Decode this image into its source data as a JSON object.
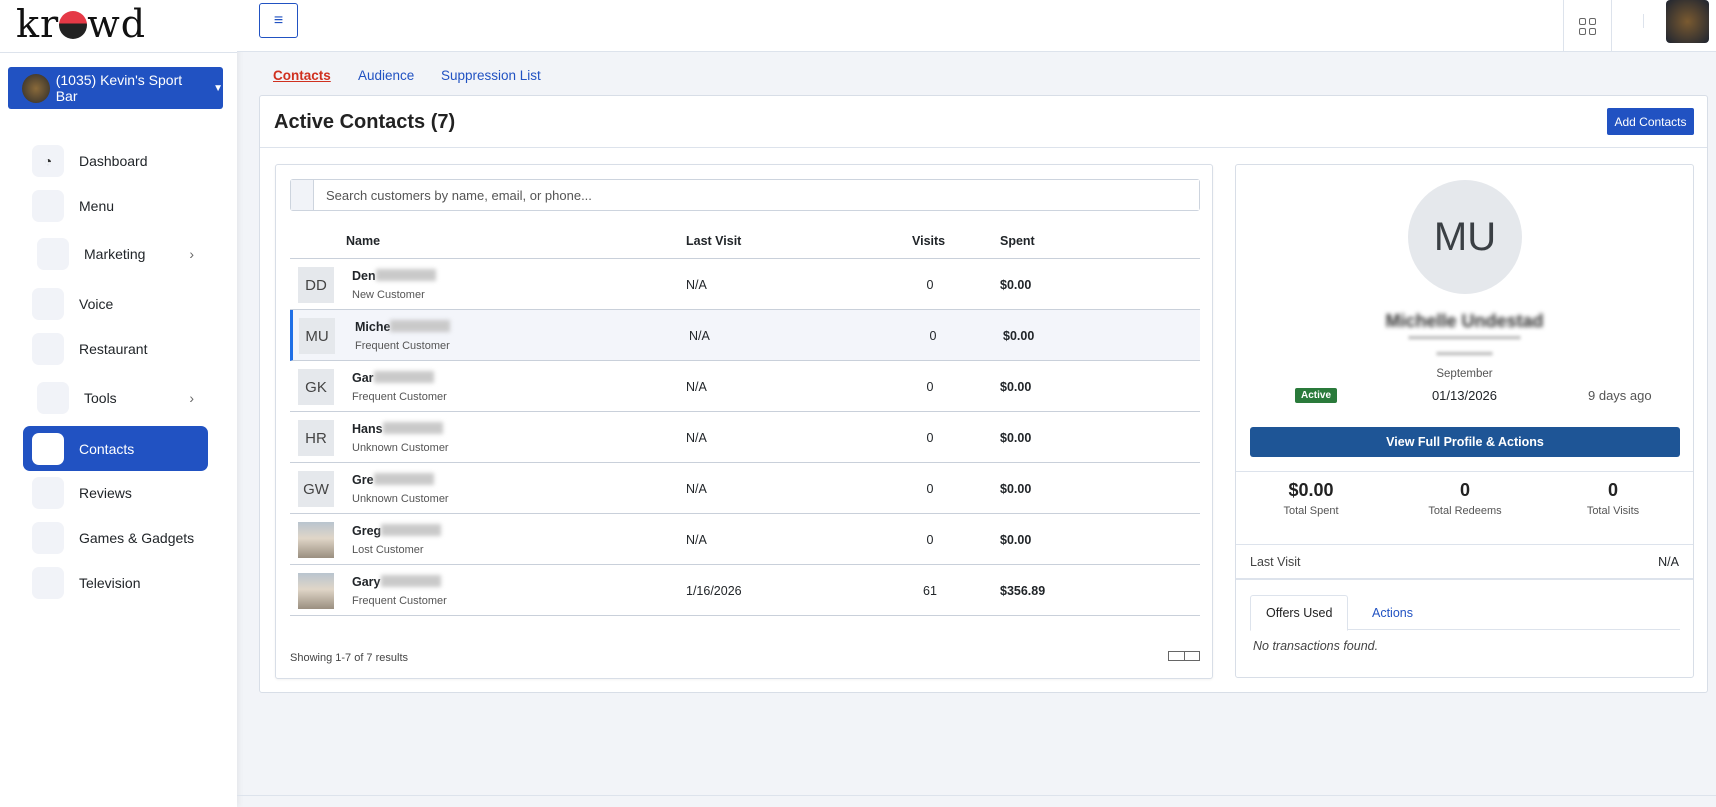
{
  "brand": {
    "logo": "krowd"
  },
  "venue": {
    "label": "(1035) Kevin's Sport Bar"
  },
  "sidebar": {
    "items": [
      {
        "label": "Dashboard",
        "icon": "gauge-icon"
      },
      {
        "label": "Menu"
      },
      {
        "label": "Marketing",
        "has_submenu": true
      },
      {
        "label": "Voice"
      },
      {
        "label": "Restaurant"
      },
      {
        "label": "Tools",
        "has_submenu": true
      },
      {
        "label": "Contacts",
        "active": true
      },
      {
        "label": "Reviews"
      },
      {
        "label": "Games & Gadgets"
      },
      {
        "label": "Television"
      }
    ]
  },
  "tabs": [
    {
      "label": "Contacts",
      "active": true
    },
    {
      "label": "Audience"
    },
    {
      "label": "Suppression List"
    }
  ],
  "main": {
    "title": "Active Contacts (7)",
    "add_label": "Add Contacts",
    "search_placeholder": "Search customers by name, email, or phone...",
    "columns": {
      "name": "Name",
      "last_visit": "Last Visit",
      "visits": "Visits",
      "spent": "Spent"
    },
    "rows": [
      {
        "initials": "DD",
        "name": "Den",
        "type": "New Customer",
        "last_visit": "N/A",
        "visits": "0",
        "spent": "$0.00"
      },
      {
        "initials": "MU",
        "name": "Miche",
        "type": "Frequent Customer",
        "last_visit": "N/A",
        "visits": "0",
        "spent": "$0.00",
        "selected": true
      },
      {
        "initials": "GK",
        "name": "Gar",
        "type": "Frequent Customer",
        "last_visit": "N/A",
        "visits": "0",
        "spent": "$0.00"
      },
      {
        "initials": "HR",
        "name": "Hans",
        "type": "Unknown Customer",
        "last_visit": "N/A",
        "visits": "0",
        "spent": "$0.00"
      },
      {
        "initials": "GW",
        "name": "Gre",
        "type": "Unknown Customer",
        "last_visit": "N/A",
        "visits": "0",
        "spent": "$0.00"
      },
      {
        "initials": "",
        "name": "Greg",
        "type": "Lost Customer",
        "last_visit": "N/A",
        "visits": "0",
        "spent": "$0.00",
        "photo": true
      },
      {
        "initials": "",
        "name": "Gary",
        "type": "Frequent Customer",
        "last_visit": "1/16/2026",
        "visits": "61",
        "spent": "$356.89",
        "photo": true
      }
    ],
    "showing": "Showing 1-7 of 7 results"
  },
  "profile": {
    "initials": "MU",
    "name": "Michelle Undestad",
    "month": "September",
    "status": "Active",
    "date": "01/13/2026",
    "ago": "9 days ago",
    "view_label": "View Full Profile & Actions",
    "stats": [
      {
        "value": "$0.00",
        "label": "Total Spent"
      },
      {
        "value": "0",
        "label": "Total Redeems"
      },
      {
        "value": "0",
        "label": "Total Visits"
      }
    ],
    "last_visit_label": "Last Visit",
    "last_visit_value": "N/A",
    "tabs": [
      {
        "label": "Offers Used"
      },
      {
        "label": "Actions"
      }
    ],
    "empty": "No transactions found."
  },
  "colors": {
    "primary": "#2152c2",
    "active_tab": "#d0301f",
    "status_active": "#2a7a3b",
    "view_button": "#1e5596"
  }
}
